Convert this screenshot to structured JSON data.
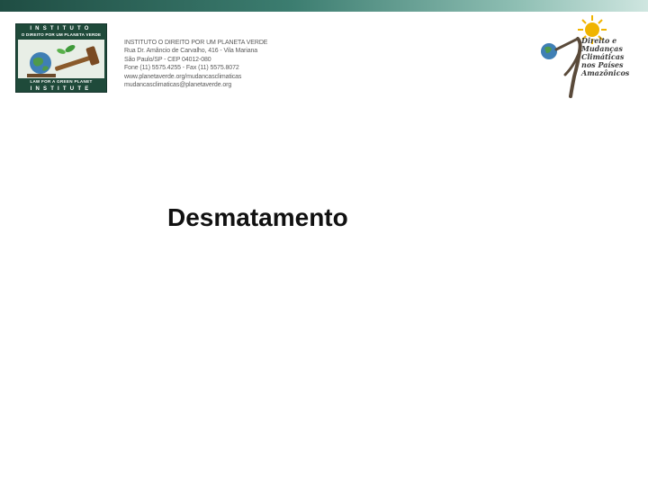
{
  "header": {
    "left_logo": {
      "line1": "INSTITUTO",
      "line2": "O DIREITO POR UM PLANETA VERDE",
      "line3": "LAW FOR A GREEN PLANET",
      "line4": "INSTITUTE"
    },
    "address": {
      "lines": [
        "INSTITUTO O DIREITO POR UM PLANETA VERDE",
        "Rua Dr. Amâncio de Carvalho, 416 - Vila Mariana",
        "São Paulo/SP - CEP 04012-080",
        "Fone (11) 5575.4255 - Fax (11) 5575.8072",
        "www.planetaverde.org/mudancasclimaticas",
        "mudancasclimaticas@planetaverde.org"
      ]
    },
    "right_logo": {
      "lines": [
        "Direito e",
        "Mudanças",
        "Climáticas",
        "nos Países",
        "Amazônicos"
      ]
    }
  },
  "slide": {
    "title": "Desmatamento"
  },
  "colors": {
    "bar_dark": "#1f4d43",
    "bar_light": "#cfe6e0",
    "logo_green": "#1f4a3a",
    "sun": "#f0b400",
    "globe": "#3f7fb5"
  }
}
